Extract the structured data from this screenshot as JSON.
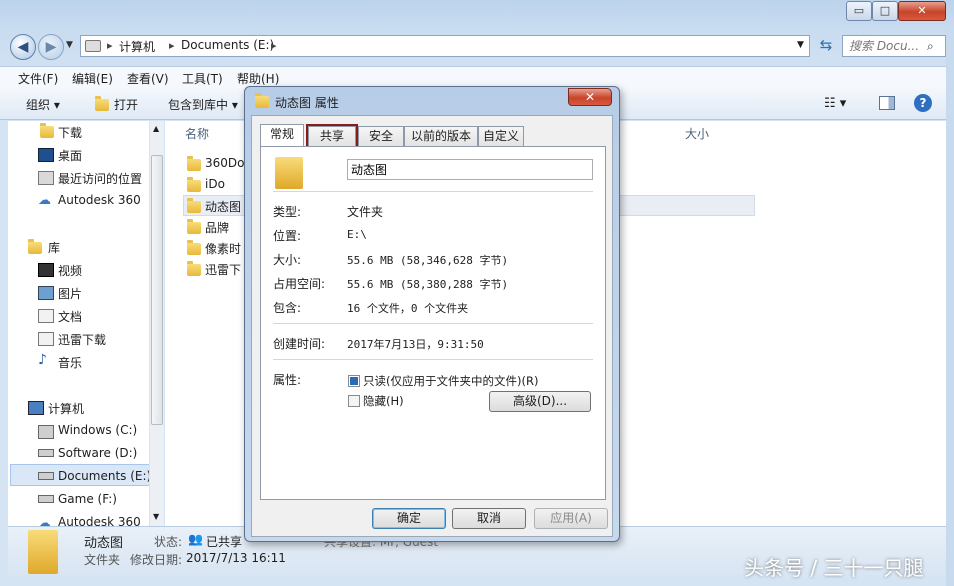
{
  "explorer": {
    "window_controls": {
      "minimize": "▭",
      "maximize": "□",
      "close": "✕"
    },
    "address": {
      "parts": [
        "计算机",
        "Documents (E:)"
      ],
      "separator": "▸"
    },
    "search_placeholder": "搜索 Docu...",
    "menu": [
      "文件(F)",
      "编辑(E)",
      "查看(V)",
      "工具(T)",
      "帮助(H)"
    ],
    "toolbar": {
      "organize": "组织 ▾",
      "open": "打开",
      "include_library": "包含到库中 ▾"
    },
    "nav": {
      "favorites": [
        "下载",
        "桌面",
        "最近访问的位置",
        "Autodesk 360"
      ],
      "libraries_title": "库",
      "libraries": [
        "视频",
        "图片",
        "文档",
        "迅雷下载",
        "音乐"
      ],
      "computer_title": "计算机",
      "drives": [
        "Windows (C:)",
        "Software (D:)",
        "Documents (E:)",
        "Game (F:)",
        "Autodesk 360"
      ]
    },
    "columns": {
      "name": "名称",
      "size": "大小"
    },
    "files": [
      "360Do",
      "iDo",
      "动态图",
      "品牌",
      "像素时",
      "迅雷下"
    ],
    "details": {
      "name": "动态图",
      "type": "文件夹",
      "state_label": "状态:",
      "state_value": "已共享",
      "modified_label": "修改日期:",
      "modified_value": "2017/7/13 16:11",
      "shared_label": "共享设置: Mr, Guest"
    }
  },
  "dialog": {
    "title": "动态图 属性",
    "close": "✕",
    "tabs": [
      "常规",
      "共享",
      "安全",
      "以前的版本",
      "自定义"
    ],
    "selected_tab": "常规",
    "highlighted_tab": "共享",
    "folder_name": "动态图",
    "props": [
      {
        "label": "类型:",
        "value": "文件夹"
      },
      {
        "label": "位置:",
        "value": "E:\\"
      },
      {
        "label": "大小:",
        "value": "55.6 MB (58,346,628 字节)"
      },
      {
        "label": "占用空间:",
        "value": "55.6 MB (58,380,288 字节)"
      },
      {
        "label": "包含:",
        "value": "16 个文件，0 个文件夹"
      }
    ],
    "created": {
      "label": "创建时间:",
      "value": "2017年7月13日，9:31:50"
    },
    "attributes": {
      "label": "属性:",
      "readonly": "只读(仅应用于文件夹中的文件)(R)",
      "hidden": "隐藏(H)",
      "advanced": "高级(D)..."
    },
    "buttons": {
      "ok": "确定",
      "cancel": "取消",
      "apply": "应用(A)"
    }
  },
  "watermark": "头条号 / 三十一只腿",
  "colors": {
    "highlight_box": "#8b1a1a",
    "selection": "#cde2f7",
    "dialog_frame": "#b7cde7"
  }
}
